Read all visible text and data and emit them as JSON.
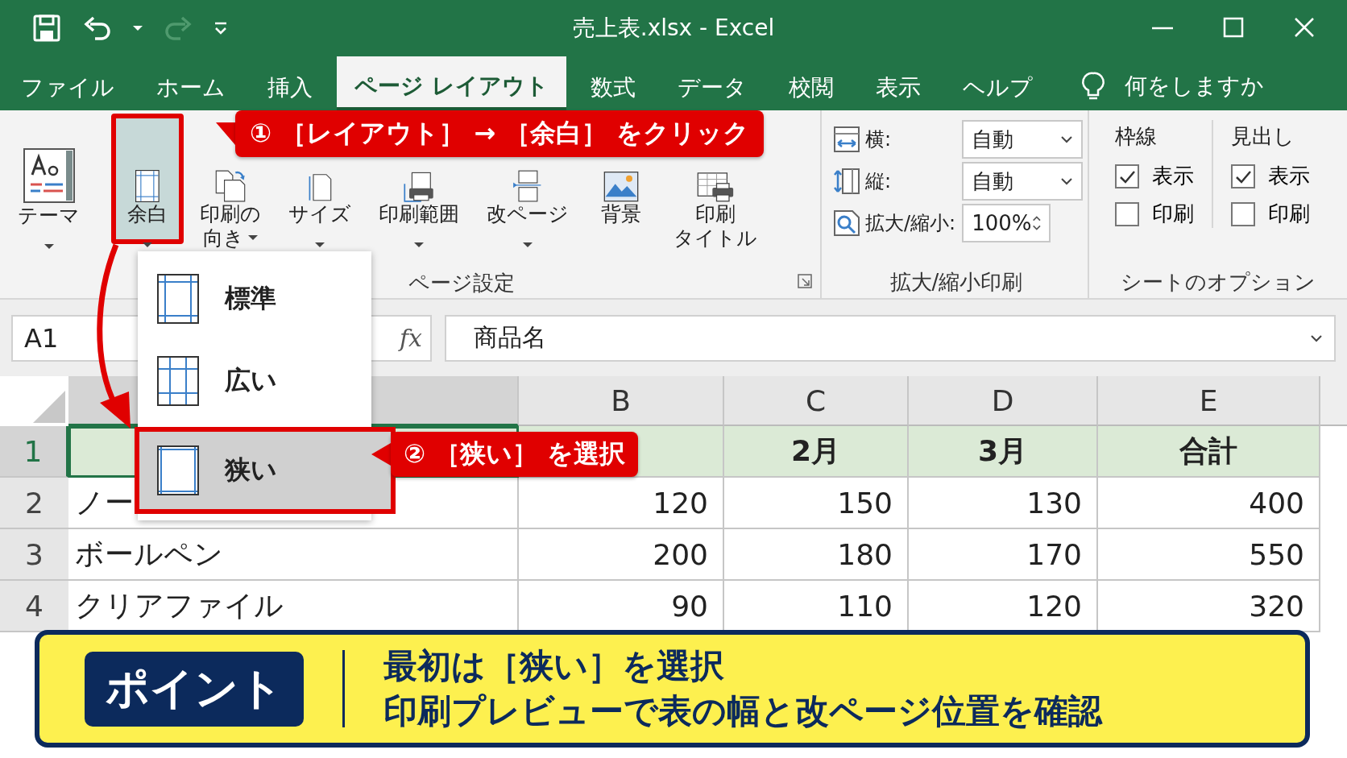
{
  "window": {
    "title": "売上表.xlsx - Excel"
  },
  "quick_access": {
    "redo_disabled": true
  },
  "tabs": [
    {
      "label": "ファイル",
      "selected": false
    },
    {
      "label": "ホーム",
      "selected": false
    },
    {
      "label": "挿入",
      "selected": false
    },
    {
      "label": "ページ レイアウト",
      "selected": true
    },
    {
      "label": "数式",
      "selected": false
    },
    {
      "label": "データ",
      "selected": false
    },
    {
      "label": "校閲",
      "selected": false
    },
    {
      "label": "表示",
      "selected": false
    },
    {
      "label": "ヘルプ",
      "selected": false
    }
  ],
  "tell_me": {
    "text": "何をしますか"
  },
  "ribbon": {
    "groups": [
      {
        "kind": "buttons",
        "buttons": [
          {
            "kind": "theme",
            "lines": [
              "テーマ"
            ],
            "dropdown": true,
            "selected": false
          }
        ]
      },
      {
        "kind": "buttons",
        "label": "ページ設定",
        "launcher": true,
        "buttons": [
          {
            "kind": "margins",
            "lines": [
              "余白"
            ],
            "dropdown": true,
            "selected": true
          },
          {
            "kind": "orientation",
            "lines": [
              "印刷の",
              "向き"
            ],
            "dropdown": true,
            "selected": false
          },
          {
            "kind": "size",
            "lines": [
              "サイズ"
            ],
            "dropdown": true,
            "selected": false
          },
          {
            "kind": "print-area",
            "lines": [
              "印刷範囲"
            ],
            "dropdown": true,
            "selected": false
          },
          {
            "kind": "breaks",
            "lines": [
              "改ページ"
            ],
            "dropdown": true,
            "selected": false
          },
          {
            "kind": "background",
            "lines": [
              "背景"
            ],
            "dropdown": false,
            "selected": false
          },
          {
            "kind": "print-titles",
            "lines": [
              "印刷",
              "タイトル"
            ],
            "dropdown": false,
            "selected": false
          }
        ]
      },
      {
        "kind": "scale",
        "label": "拡大/縮小印刷",
        "rows": [
          {
            "kind": "width",
            "label": "横:",
            "value": "自動"
          },
          {
            "kind": "height",
            "label": "縦:",
            "value": "自動"
          },
          {
            "kind": "zoom",
            "label": "拡大/縮小:",
            "value": "100%"
          }
        ]
      },
      {
        "kind": "options",
        "label": "シートのオプション",
        "columns": [
          {
            "title": "枠線",
            "items": [
              {
                "label": "表示",
                "checked": true
              },
              {
                "label": "印刷",
                "checked": false
              }
            ]
          },
          {
            "title": "見出し",
            "items": [
              {
                "label": "表示",
                "checked": true
              },
              {
                "label": "印刷",
                "checked": false
              }
            ]
          }
        ]
      }
    ]
  },
  "formula_bar": {
    "name_box": "A1",
    "function_label": "fx",
    "formula": "商品名"
  },
  "sheet": {
    "columns": [
      {
        "selected": true
      },
      {
        "label": "B",
        "selected": false
      },
      {
        "label": "C",
        "selected": false
      },
      {
        "label": "D",
        "selected": false
      },
      {
        "label": "E",
        "selected": false
      }
    ],
    "rows": [
      {
        "number": "1",
        "selected": true,
        "header": true,
        "cells": [
          {
            "active": true
          },
          {
            "active": false
          },
          {
            "text": "2月",
            "active": false
          },
          {
            "text": "3月",
            "active": false
          },
          {
            "text": "合計",
            "active": false
          }
        ]
      },
      {
        "number": "2",
        "selected": false,
        "header": false,
        "cells": [
          {
            "text": "ノー",
            "active": false
          },
          {
            "text": "120",
            "active": false
          },
          {
            "text": "150",
            "active": false
          },
          {
            "text": "130",
            "active": false
          },
          {
            "text": "400",
            "active": false
          }
        ]
      },
      {
        "number": "3",
        "selected": false,
        "header": false,
        "cells": [
          {
            "text": "ボールペン",
            "active": false
          },
          {
            "text": "200",
            "active": false
          },
          {
            "text": "180",
            "active": false
          },
          {
            "text": "170",
            "active": false
          },
          {
            "text": "550",
            "active": false
          }
        ]
      },
      {
        "number": "4",
        "selected": false,
        "header": false,
        "cells": [
          {
            "text": "クリアファイル",
            "active": false
          },
          {
            "text": "90",
            "active": false
          },
          {
            "text": "110",
            "active": false
          },
          {
            "text": "120",
            "active": false
          },
          {
            "text": "320",
            "active": false
          }
        ]
      }
    ]
  },
  "margins_menu": {
    "items": [
      {
        "kind": "normal",
        "label": "標準",
        "selected": false
      },
      {
        "kind": "wide",
        "label": "広い",
        "selected": false
      },
      {
        "kind": "narrow",
        "label": "狭い",
        "selected": true
      }
    ]
  },
  "annotations": [
    {
      "kind": "step",
      "text": "① ［レイアウト］ → ［余白］ をクリック"
    },
    {
      "kind": "step",
      "text": "② ［狭い］ を選択"
    }
  ],
  "point_banner": {
    "badge": "ポイント",
    "lines": [
      "最初は［狭い］を選択",
      "印刷プレビューで表の幅と改ページ位置を確認"
    ]
  }
}
